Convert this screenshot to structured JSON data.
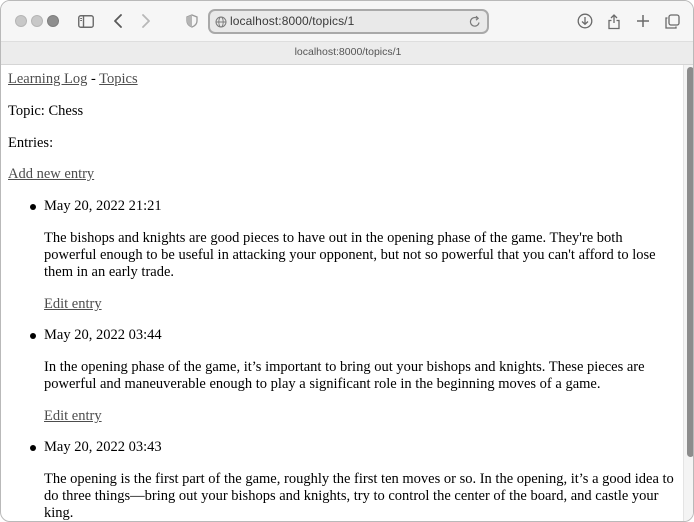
{
  "browser": {
    "url": "localhost:8000/topics/1",
    "tab_title": "localhost:8000/topics/1"
  },
  "page": {
    "nav": {
      "home_link": "Learning Log",
      "separator": "-",
      "topics_link": "Topics"
    },
    "topic_heading": "Topic: Chess",
    "entries_label": "Entries:",
    "add_entry_link": "Add new entry",
    "entries": [
      {
        "date": "May 20, 2022 21:21",
        "text": "The bishops and knights are good pieces to have out in the opening phase of the game. They're both powerful enough to be useful in attacking your opponent, but not so powerful that you can't afford to lose them in an early trade.",
        "edit_link": "Edit entry"
      },
      {
        "date": "May 20, 2022 03:44",
        "text": "In the opening phase of the game, it’s important to bring out your bishops and knights. These pieces are powerful and maneuverable enough to play a significant role in the beginning moves of a game.",
        "edit_link": "Edit entry"
      },
      {
        "date": "May 20, 2022 03:43",
        "text": "The opening is the first part of the game, roughly the first ten moves or so. In the opening, it’s a good idea to do three things—bring out your bishops and knights, try to control the center of the board, and castle your king.",
        "edit_link": ""
      }
    ]
  }
}
